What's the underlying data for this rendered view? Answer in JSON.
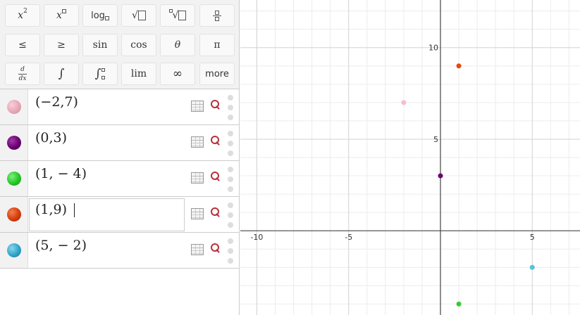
{
  "keypad": {
    "row1": [
      "x2",
      "x□",
      "log□",
      "√□",
      "□√□",
      "□/□"
    ],
    "row2": {
      "le": "≤",
      "ge": "≥",
      "sin": "sin",
      "cos": "cos",
      "theta": "θ",
      "pi": "π"
    },
    "row3": {
      "ddx_top": "d",
      "ddx_bottom": "dx",
      "integral": "∫",
      "defint": "∫",
      "lim": "lim",
      "infinity": "∞",
      "more": "more"
    }
  },
  "expressions": [
    {
      "latex": "(−2,7)",
      "color": "#e8a6b6",
      "x": -2,
      "y": 7
    },
    {
      "latex": "(0,3)",
      "color": "#6b0070",
      "x": 0,
      "y": 3
    },
    {
      "latex": "(1, − 4)",
      "color": "#22c722",
      "x": 1,
      "y": -4
    },
    {
      "latex": "(1,9)",
      "color": "#d43c0c",
      "x": 1,
      "y": 9,
      "active": true
    },
    {
      "latex": "(5, − 2)",
      "color": "#2ea4c8",
      "x": 5,
      "y": -2
    }
  ],
  "graph": {
    "xlim": [
      -10.9,
      7.6
    ],
    "ylim": [
      -4.6,
      12.6
    ],
    "x_ticks": [
      {
        "v": -10,
        "label": "-10"
      },
      {
        "v": -5,
        "label": "-5"
      },
      {
        "v": 5,
        "label": "5"
      }
    ],
    "y_ticks": [
      {
        "v": 5,
        "label": "5"
      },
      {
        "v": 10,
        "label": "10"
      }
    ],
    "point_colors": {
      "p1": "#f7bcd0",
      "p2": "#6b0070",
      "p3": "#33cc33",
      "p4": "#e04a10",
      "p5": "#4cc6d8"
    }
  }
}
